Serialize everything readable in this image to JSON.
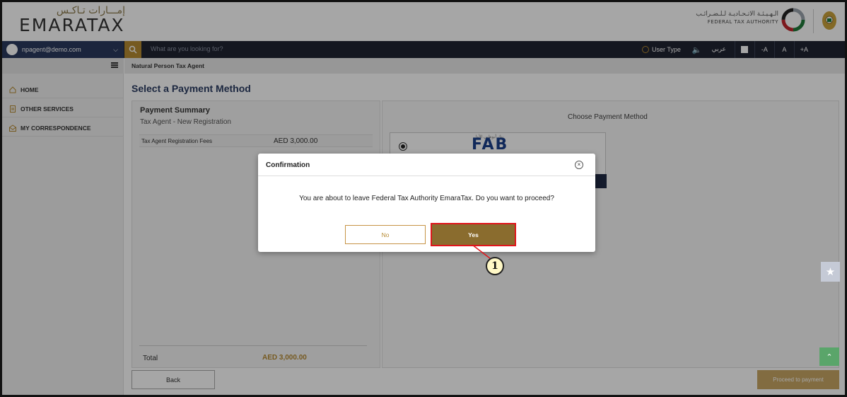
{
  "brand": {
    "arabic": "إمـــارات تـاكـس",
    "name": "EMARATAX"
  },
  "authority": {
    "arabic": "الـهـيـئـة الاتـحـاديـة لـلـضـرائـب",
    "english": "FEDERAL TAX AUTHORITY"
  },
  "topbar": {
    "user_email": "npagent@demo.com",
    "search_placeholder": "What are you looking for?",
    "user_type": "User Type",
    "arabic_toggle": "عربي",
    "font_minus": "-A",
    "font_reset": "A",
    "font_plus": "+A"
  },
  "sidebar": {
    "items": [
      {
        "label": "HOME",
        "icon": "home-icon"
      },
      {
        "label": "OTHER SERVICES",
        "icon": "document-icon"
      },
      {
        "label": "MY CORRESPONDENCE",
        "icon": "correspondence-icon"
      }
    ]
  },
  "breadcrumb": "Natural Person Tax Agent",
  "page_title": "Select a Payment Method",
  "summary": {
    "title": "Payment Summary",
    "subtitle": "Tax Agent - New Registration",
    "fee_label": "Tax Agent Registration Fees",
    "fee_value": "AED 3,000.00",
    "total_label": "Total",
    "total_value": "AED 3,000.00"
  },
  "payment": {
    "heading": "Choose Payment Method",
    "bank_logo": "FAB",
    "bank_logo_ar": "بنك أبوظبي الأول"
  },
  "actions": {
    "back": "Back",
    "proceed": "Proceed to payment"
  },
  "dialog": {
    "title": "Confirmation",
    "message": "You are about to leave Federal Tax Authority EmaraTax. Do you want to proceed?",
    "no": "No",
    "yes": "Yes"
  },
  "annotation": {
    "step": "1"
  },
  "colors": {
    "gold": "#b68a32",
    "navy": "#2b3d63",
    "highlight": "#e0151b"
  }
}
